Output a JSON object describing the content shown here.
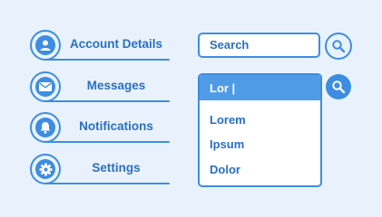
{
  "menu": {
    "items": [
      {
        "label": "Account Details",
        "icon": "user-icon"
      },
      {
        "label": "Messages",
        "icon": "envelope-icon"
      },
      {
        "label": "Notifications",
        "icon": "bell-icon"
      },
      {
        "label": "Settings",
        "icon": "gear-icon"
      }
    ]
  },
  "search": {
    "placeholder": "Search",
    "active_value": "Lor |",
    "suggestions": [
      "Lorem",
      "Ipsum",
      "Dolor"
    ]
  },
  "colors": {
    "background": "#e9f2fc",
    "accent": "#3d8de0",
    "text": "#2a6fc2",
    "input_highlight": "#4f9be6"
  }
}
